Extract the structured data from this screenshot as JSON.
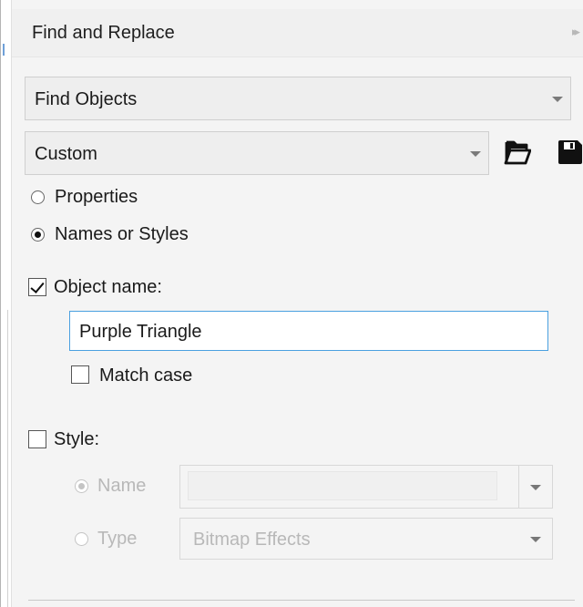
{
  "panel": {
    "title": "Find and Replace",
    "collapse_icon": "double-chevron-right-icon"
  },
  "find_mode": {
    "selected": "Find Objects"
  },
  "preset": {
    "selected": "Custom",
    "open_icon": "folder-open-icon",
    "save_icon": "floppy-disk-icon"
  },
  "search_type": {
    "properties_label": "Properties",
    "names_label": "Names or Styles",
    "selected": "Names or Styles"
  },
  "object_name": {
    "label": "Object name:",
    "checked": true,
    "value": "Purple Triangle",
    "match_case_label": "Match case",
    "match_case_checked": false
  },
  "style": {
    "label": "Style:",
    "checked": false,
    "name_label": "Name",
    "type_label": "Type",
    "selected_option": "Name",
    "name_value": "",
    "type_value": "Bitmap Effects"
  },
  "colors": {
    "focus_border": "#4aa0e0",
    "disabled_text": "#b8b8b8",
    "panel_bg": "#f4f4f4"
  }
}
